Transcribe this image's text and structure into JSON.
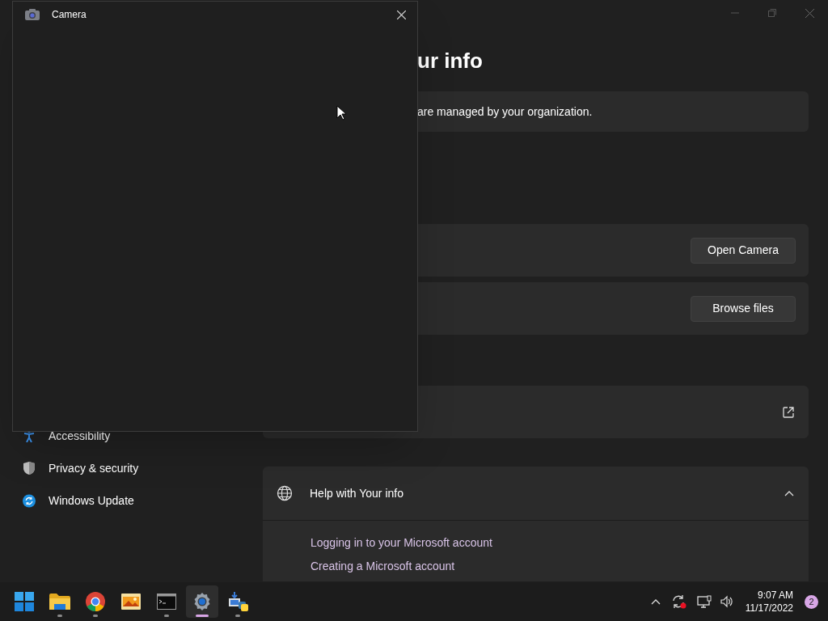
{
  "settings_window": {
    "page_title": "ur info",
    "notice": "are managed by your organization.",
    "actions": [
      {
        "kind": "button",
        "label": "Open Camera"
      },
      {
        "kind": "button",
        "label": "Browse files"
      },
      {
        "kind": "external"
      }
    ],
    "sidebar": {
      "items": [
        {
          "kind": "accessibility",
          "label": "Accessibility"
        },
        {
          "kind": "privacy",
          "label": "Privacy & security"
        },
        {
          "kind": "update",
          "label": "Windows Update"
        }
      ]
    },
    "help": {
      "title": "Help with Your info",
      "expanded": true,
      "links": [
        "Logging in to your Microsoft account",
        "Creating a Microsoft account"
      ]
    }
  },
  "camera_window": {
    "title": "Camera"
  },
  "taskbar": {
    "apps": [
      {
        "kind": "start",
        "running": false,
        "active": false
      },
      {
        "kind": "folder",
        "running": true,
        "active": false
      },
      {
        "kind": "browser",
        "running": true,
        "active": false
      },
      {
        "kind": "photos",
        "running": false,
        "active": false
      },
      {
        "kind": "terminal",
        "running": true,
        "active": false
      },
      {
        "kind": "settings",
        "running": true,
        "active": true
      },
      {
        "kind": "setup",
        "running": true,
        "active": false
      }
    ],
    "time": "9:07 AM",
    "date": "11/17/2022",
    "notification_count": "2"
  }
}
